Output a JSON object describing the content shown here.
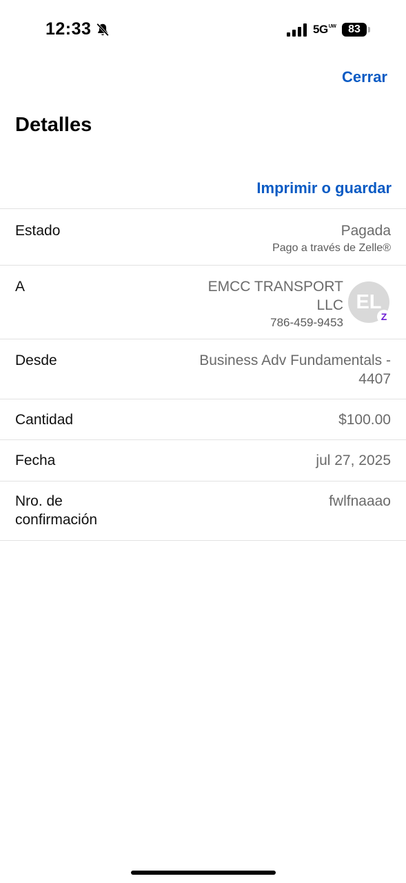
{
  "status_bar": {
    "time": "12:33",
    "network": "5G",
    "network_sup": "UW",
    "battery": "83"
  },
  "header": {
    "close_label": "Cerrar",
    "title": "Detalles",
    "print_label": "Imprimir o guardar"
  },
  "details": {
    "estado": {
      "label": "Estado",
      "value": "Pagada",
      "sub": "Pago a través de Zelle®"
    },
    "recipient": {
      "label": "A",
      "name_line1": "EMCC TRANSPORT",
      "name_line2": "LLC",
      "phone": "786-459-9453",
      "initials": "EL",
      "badge": "Z"
    },
    "from": {
      "label": "Desde",
      "value_line1": "Business Adv Fundamentals -",
      "value_line2": "4407"
    },
    "amount": {
      "label": "Cantidad",
      "value": "$100.00"
    },
    "date": {
      "label": "Fecha",
      "value": "jul 27, 2025"
    },
    "confirmation": {
      "label_line1": "Nro. de",
      "label_line2": "confirmación",
      "value": "fwlfnaaao"
    }
  },
  "colors": {
    "link": "#0a5bc4",
    "muted_text": "#6b6b6b",
    "divider": "#e2e2e2",
    "avatar_bg": "#d9d9d9",
    "zelle_purple": "#6d1ed4"
  }
}
